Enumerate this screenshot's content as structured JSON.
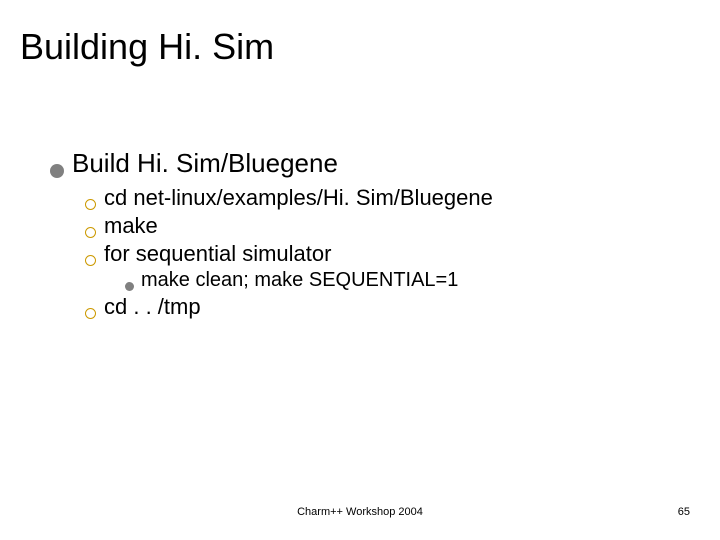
{
  "title": "Building Hi. Sim",
  "body": {
    "l1": {
      "text": "Build Hi. Sim/Bluegene"
    },
    "l2a": {
      "text": "cd net-linux/examples/Hi. Sim/Bluegene"
    },
    "l2b": {
      "text": "make"
    },
    "l2c": {
      "text": "for sequential simulator"
    },
    "l3a": {
      "text": "make clean; make SEQUENTIAL=1"
    },
    "l2d": {
      "text": "cd . . /tmp"
    }
  },
  "footer": {
    "center": "Charm++ Workshop 2004",
    "page": "65"
  }
}
